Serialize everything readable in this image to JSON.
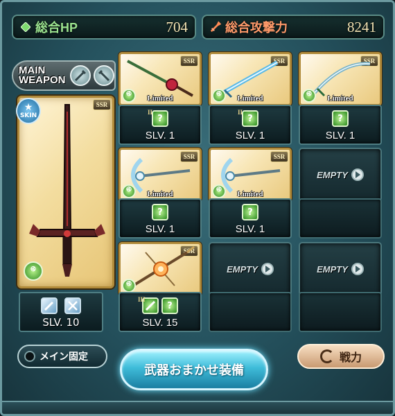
{
  "stats": {
    "hp_label": "総合HP",
    "hp_value": "704",
    "atk_label": "総合攻撃力",
    "atk_value": "8241"
  },
  "main_weapon": {
    "label_line1": "MAIN",
    "label_line2": "WEAPON",
    "skin_label": "SKIN",
    "rarity": "SSR",
    "skill_level": "SLV. 10"
  },
  "grid": {
    "rarity": "SSR",
    "limited_label": "Limited",
    "empty_label": "EMPTY",
    "slot_row1": [
      {
        "skill_level": "SLV. 1",
        "roman": "II"
      },
      {
        "skill_level": "SLV. 1",
        "roman": "II"
      },
      {
        "skill_level": "SLV. 1",
        "roman": ""
      }
    ],
    "slot_row2": [
      {
        "skill_level": "SLV. 1"
      },
      {
        "skill_level": "SLV. 1"
      }
    ],
    "slot_row3": [
      {
        "skill_level": "SLV. 15",
        "roman": "III"
      }
    ]
  },
  "buttons": {
    "lock_main": "メイン固定",
    "auto_equip": "武器おまかせ装備",
    "power": "戦力"
  },
  "colors": {
    "hp": "#9be38f",
    "atk": "#ff9a6a",
    "value": "#f2e2b2"
  }
}
